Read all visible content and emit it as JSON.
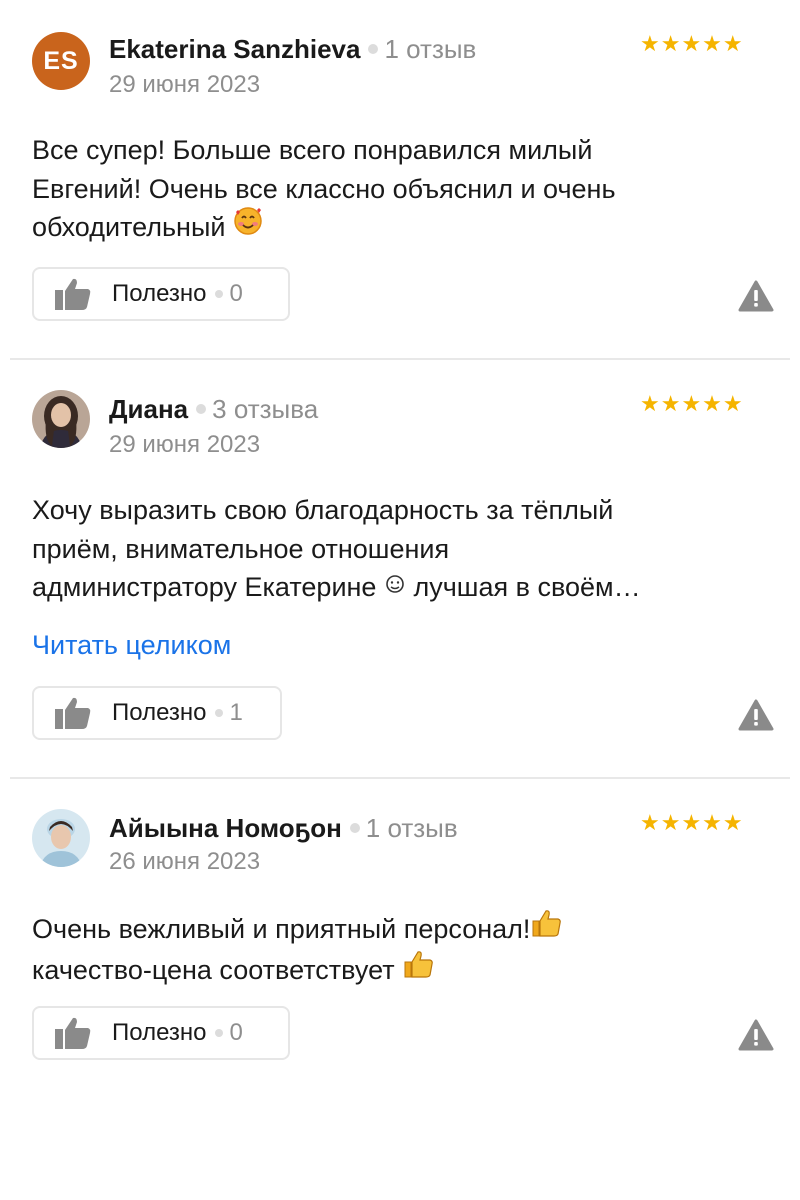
{
  "reviews": [
    {
      "initials": "ES",
      "author": "Ekaterina Sanzhieva",
      "review_count": "1 отзыв",
      "date": "29 июня 2023",
      "rating": 5,
      "rating_stars": "★★★★★",
      "text_lines": [
        "Все супер! Больше всего понравился милый",
        "Евгений! Очень все классно объяснил и очень",
        "обходительный"
      ],
      "emoji": "smiling-face-with-hearts",
      "useful_label": "Полезно",
      "useful_count": "0"
    },
    {
      "author": "Диана",
      "review_count": "3 отзыва",
      "date": "29 июня 2023",
      "rating": 5,
      "rating_stars": "★★★★★",
      "text_lines": [
        "Хочу выразить свою благодарность за тёплый",
        "приём, внимательное отношения",
        "администратору Екатерине",
        "лучшая в своём…"
      ],
      "read_more": "Читать целиком",
      "useful_label": "Полезно",
      "useful_count": "1"
    },
    {
      "author": "Айыына Номоҕон",
      "review_count": "1 отзыв",
      "date": "26 июня 2023",
      "rating": 5,
      "rating_stars": "★★★★★",
      "text_lines": [
        "Очень вежливый и приятный персонал!",
        "качество-цена соответствует"
      ],
      "emoji": "thumbs-up",
      "useful_label": "Полезно",
      "useful_count": "0"
    }
  ],
  "colors": {
    "star": "#f5b400",
    "link": "#1a73e8",
    "muted": "#8e8e8e",
    "avatar_initials_bg": "#c9641c"
  }
}
